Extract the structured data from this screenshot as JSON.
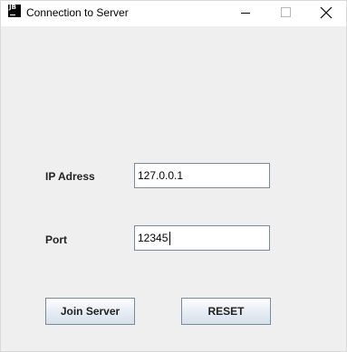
{
  "window": {
    "title": "Connection to Server",
    "app_icon_label": "JB",
    "icons": {
      "app": "jetbrains-app-icon",
      "minimize": "minimize-icon",
      "maximize": "maximize-icon",
      "close": "close-icon"
    }
  },
  "form": {
    "ip_label": "IP Adress",
    "ip_value": "127.0.0.1",
    "port_label": "Port",
    "port_value": "12345"
  },
  "buttons": {
    "join_label": "Join Server",
    "reset_label": "RESET"
  },
  "colors": {
    "window_background": "#efefef",
    "titlebar_background": "#ffffff",
    "field_border": "#7a8a99"
  }
}
